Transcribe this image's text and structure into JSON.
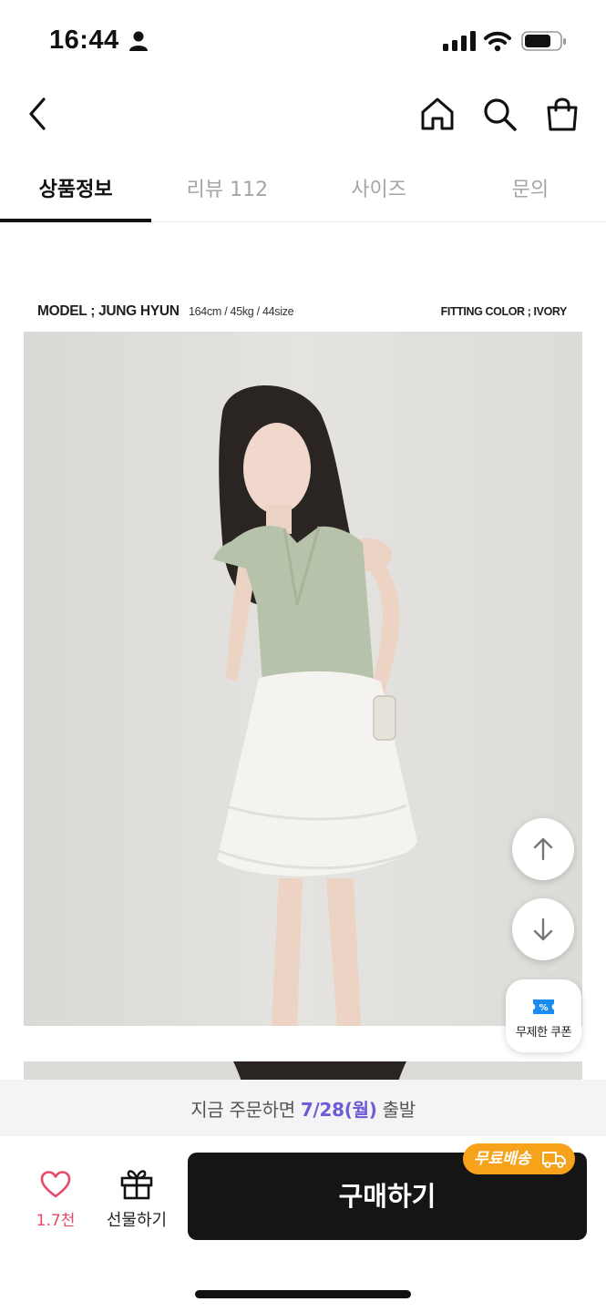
{
  "status_bar": {
    "time": "16:44"
  },
  "tabs": [
    {
      "label": "상품정보",
      "active": true
    },
    {
      "label": "리뷰 112",
      "active": false
    },
    {
      "label": "사이즈",
      "active": false
    },
    {
      "label": "문의",
      "active": false
    }
  ],
  "product": {
    "model_label": "MODEL ; JUNG HYUN",
    "model_spec": "164cm / 45kg / 44size",
    "fitting_color": "FITTING COLOR ; IVORY"
  },
  "coupon": {
    "label": "무제한 쿠폰"
  },
  "shipping": {
    "prefix": "지금 주문하면 ",
    "date": "7/28(월)",
    "suffix": " 출발"
  },
  "actions": {
    "like_count": "1.7천",
    "gift_label": "선물하기",
    "buy_label": "구매하기",
    "free_shipping_badge": "무료배송"
  },
  "colors": {
    "accent_purple": "#6b5cd6",
    "like_pink": "#e84866",
    "badge_orange": "#f7a21b",
    "buy_button": "#151515"
  }
}
